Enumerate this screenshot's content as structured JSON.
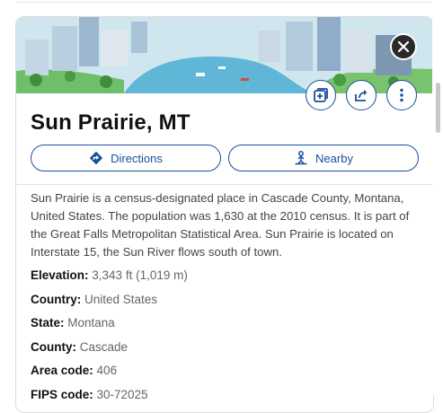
{
  "place": {
    "title": "Sun Prairie, MT",
    "description": "Sun Prairie is a census-designated place in Cascade County, Montana, United States. The population was 1,630 at the 2010 census. It is part of the Great Falls Metropolitan Statistical Area. Sun Prairie is located on Interstate 15, the Sun River flows south of town."
  },
  "buttons": {
    "directions": "Directions",
    "nearby": "Nearby"
  },
  "icons": {
    "close": "close-icon",
    "save": "add-to-collection-icon",
    "share": "share-icon",
    "more": "more-vertical-icon",
    "directions": "directions-diamond-icon",
    "nearby": "nearby-person-icon"
  },
  "facts": [
    {
      "label": "Elevation:",
      "value": "3,343 ft (1,019 m)"
    },
    {
      "label": "Country:",
      "value": "United States"
    },
    {
      "label": "State:",
      "value": "Montana"
    },
    {
      "label": "County:",
      "value": "Cascade"
    },
    {
      "label": "Area code:",
      "value": "406"
    },
    {
      "label": "FIPS code:",
      "value": "30-72025"
    }
  ],
  "colors": {
    "accent": "#1a4e9c",
    "close_bg": "#2a2a2a"
  }
}
